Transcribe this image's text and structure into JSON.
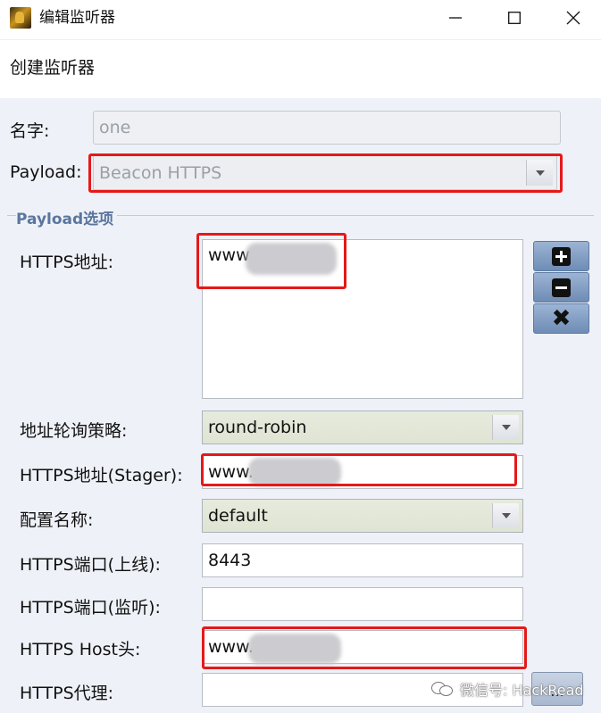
{
  "window": {
    "title": "编辑监听器",
    "minimize_label": "",
    "maximize_label": "",
    "close_label": ""
  },
  "header": {
    "text": "创建监听器"
  },
  "form": {
    "name_label": "名字:",
    "name_value": "one",
    "payload_label": "Payload:",
    "payload_value": "Beacon HTTPS",
    "section_title": "Payload选项",
    "https_hosts_label": "HTTPS地址:",
    "https_hosts": [
      "www"
    ],
    "rotate_label": "地址轮询策略:",
    "rotate_value": "round-robin",
    "stager_label": "HTTPS地址(Stager):",
    "stager_value": "www.",
    "profile_label": "配置名称:",
    "profile_value": "default",
    "port_c2_label": "HTTPS端口(上线):",
    "port_c2_value": "8443",
    "port_bind_label": "HTTPS端口(监听):",
    "port_bind_value": "",
    "host_header_label": "HTTPS Host头:",
    "host_header_value": "www.",
    "proxy_label": "HTTPS代理:",
    "proxy_value": "",
    "proxy_button_label": "..."
  },
  "icons": {
    "add": "plus-icon",
    "remove": "minus-icon",
    "clear": "x-icon"
  },
  "watermark": {
    "text": "微信号: HackRead"
  },
  "colors": {
    "panel_bg": "#eef1f7",
    "section_title": "#5a76a0",
    "highlight_red": "#e51919",
    "tool_button": "#7a96bd"
  }
}
